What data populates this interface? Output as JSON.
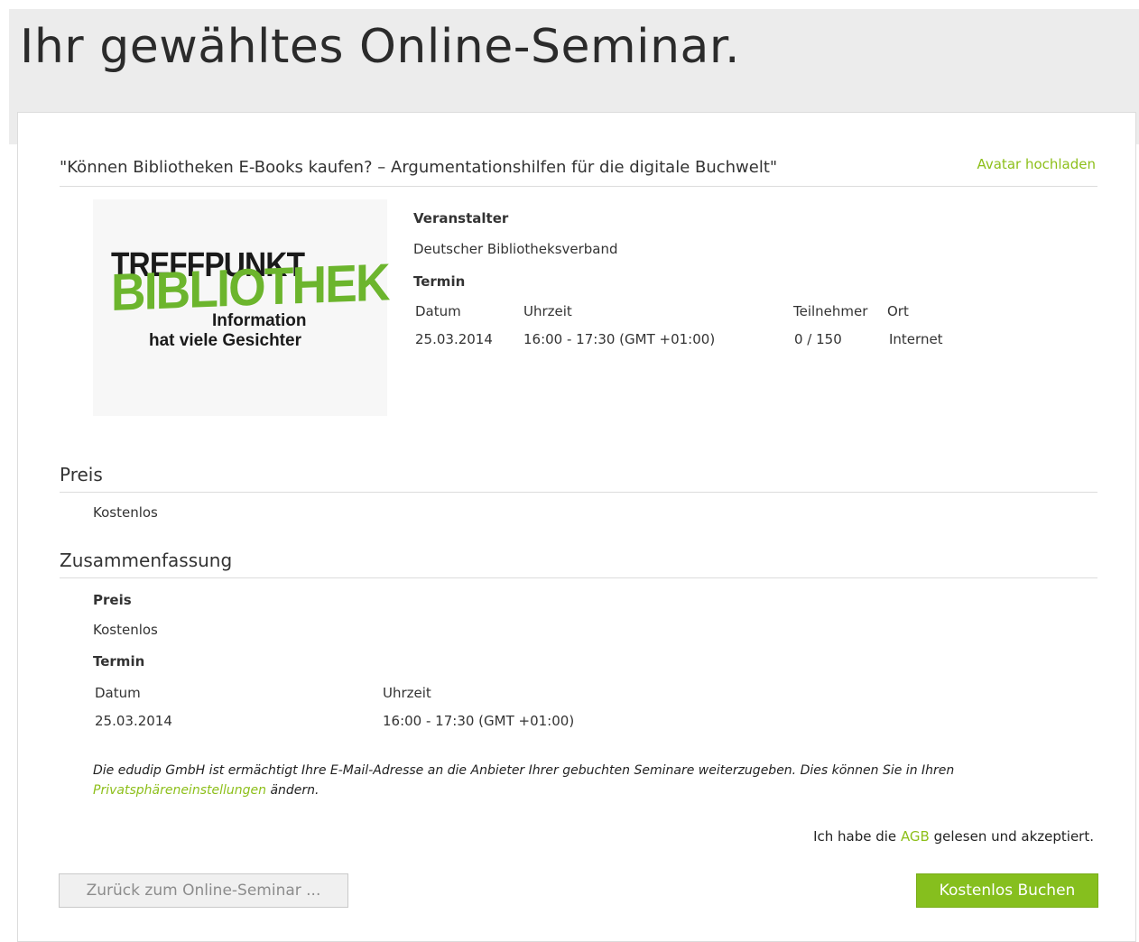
{
  "page": {
    "title": "Ihr gewähltes Online-Seminar."
  },
  "seminar": {
    "title": "\"Können Bibliotheken E-Books kaufen? – Argumentationshilfen für die digitale Buchwelt\"",
    "avatar_link": "Avatar hochladen",
    "logo": {
      "line1": "TREFFPUNKT",
      "line2": "BIBLIOTHEK",
      "line3": "Information",
      "line4": "hat viele Gesichter"
    },
    "organizer_label": "Veranstalter",
    "organizer": "Deutscher Bibliotheksverband",
    "schedule_label": "Termin",
    "columns": {
      "date": "Datum",
      "time": "Uhrzeit",
      "participants": "Teilnehmer",
      "location": "Ort"
    },
    "row": {
      "date": "25.03.2014",
      "time": "16:00 - 17:30 (GMT +01:00)",
      "participants": "0 / 150",
      "location": "Internet"
    }
  },
  "price": {
    "heading": "Preis",
    "value": "Kostenlos"
  },
  "summary": {
    "heading": "Zusammenfassung",
    "price_label": "Preis",
    "price_value": "Kostenlos",
    "schedule_label": "Termin",
    "col_date": "Datum",
    "col_time": "Uhrzeit",
    "date": "25.03.2014",
    "time": "16:00 - 17:30 (GMT +01:00)"
  },
  "notice": {
    "text_before": "Die edudip GmbH ist ermächtigt Ihre E-Mail-Adresse an die Anbieter Ihrer gebuchten Seminare weiterzugeben. Dies können Sie in Ihren ",
    "link": "Privatsphäreneinstellungen",
    "text_after": " ändern."
  },
  "agb": {
    "text_before": "Ich habe die ",
    "link": "AGB",
    "text_after": " gelesen und akzeptiert."
  },
  "buttons": {
    "back": "Zurück zum Online-Seminar ...",
    "book": "Kostenlos Buchen"
  },
  "colors": {
    "accent": "#8dbf1a",
    "button_green": "#86bf1e",
    "header_bg": "#ececec"
  }
}
